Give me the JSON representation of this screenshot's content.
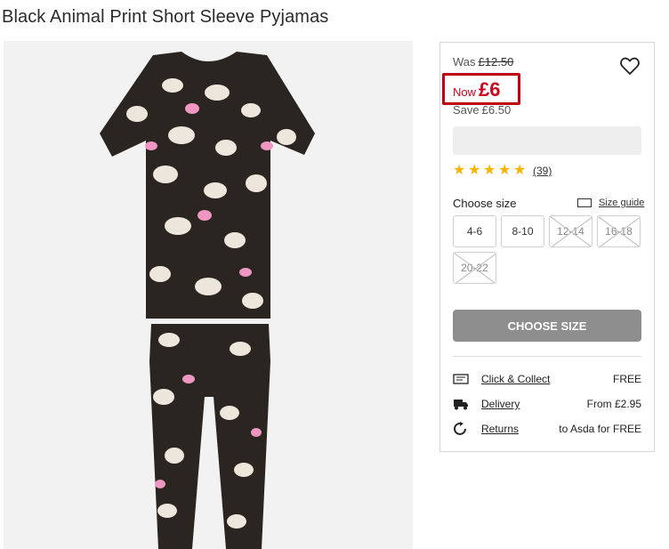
{
  "product": {
    "title": "Black Animal Print Short Sleeve Pyjamas"
  },
  "pricing": {
    "was_label": "Was",
    "was_price": "£12.50",
    "now_label": "Now",
    "now_price": "£6",
    "save_label": "Save",
    "save_amount": "£6.50"
  },
  "rating": {
    "stars": 5,
    "count": "(39)"
  },
  "size": {
    "label": "Choose size",
    "guide_label": "Size guide",
    "options": [
      {
        "label": "4-6",
        "available": true
      },
      {
        "label": "8-10",
        "available": true
      },
      {
        "label": "12-14",
        "available": false
      },
      {
        "label": "16-18",
        "available": false
      },
      {
        "label": "20-22",
        "available": false
      }
    ]
  },
  "cta": {
    "label": "CHOOSE SIZE"
  },
  "delivery": [
    {
      "icon": "click-collect-icon",
      "label": "Click & Collect",
      "value": "FREE"
    },
    {
      "icon": "delivery-truck-icon",
      "label": "Delivery",
      "value": "From £2.95"
    },
    {
      "icon": "returns-icon",
      "label": "Returns",
      "value": "to Asda for FREE"
    }
  ],
  "colors": {
    "sale_red": "#d0021b",
    "star_gold": "#f5b400",
    "cta_grey": "#8e8e8e"
  }
}
